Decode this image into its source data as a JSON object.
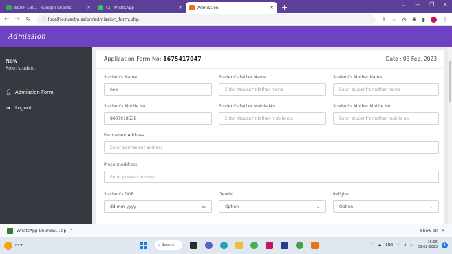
{
  "browser": {
    "tabs": [
      {
        "label": "SCRF-1301 - Google Sheets",
        "color": "#34a853"
      },
      {
        "label": "(2) WhatsApp",
        "color": "#25d366"
      },
      {
        "label": "Admission",
        "color": "#e8711a"
      }
    ],
    "new_tab": "+",
    "url": "localhost/admission/admission_form.php"
  },
  "app": {
    "brand": "Admission",
    "accent": "#6f42c1"
  },
  "sidebar": {
    "user": "New",
    "role": "Role: student",
    "items": [
      {
        "label": "Admission Form",
        "icon": "user-icon"
      },
      {
        "label": "Logout",
        "icon": "logout-icon"
      }
    ]
  },
  "form": {
    "app_no_label": "Application Form No:",
    "app_no": "1675417047",
    "date": "Date : 03 Feb, 2023",
    "student_name": {
      "label": "Student's Name",
      "value": "new"
    },
    "father_name": {
      "label": "Student's Father Name",
      "placeholder": "Enter student's father name"
    },
    "mother_name": {
      "label": "Student's Mother Name",
      "placeholder": "Enter student's mother name"
    },
    "student_mobile": {
      "label": "Student's Mobile No.",
      "value": "8007918538"
    },
    "father_mobile": {
      "label": "Student's Father Mobile No.",
      "placeholder": "Enter student's father mobile no."
    },
    "mother_mobile": {
      "label": "Student's Mother Mobile No.",
      "placeholder": "Enter student's mother mobile no."
    },
    "permanent_address": {
      "label": "Permanent Address",
      "placeholder": "Enter permanent address"
    },
    "present_address": {
      "label": "Present Address",
      "placeholder": "Enter present address"
    },
    "dob": {
      "label": "Student's DOB",
      "placeholder": "dd-mm-yyyy"
    },
    "gender": {
      "label": "Gender",
      "selected": "Option"
    },
    "religion": {
      "label": "Religion",
      "selected": "Option"
    }
  },
  "downloads": {
    "file": "WhatsApp Unknow....zip",
    "show_all": "Show all"
  },
  "taskbar": {
    "weather": "81°F",
    "search": "Search",
    "lang": "ENG",
    "time": "15:06",
    "date": "03-02-2023",
    "notifications": "1"
  }
}
